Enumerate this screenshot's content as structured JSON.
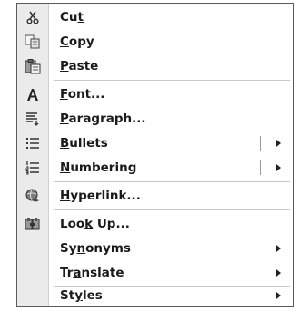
{
  "menu": {
    "items": [
      {
        "pre": "Cu",
        "u": "t",
        "post": "",
        "icon": "cut-icon"
      },
      {
        "pre": "",
        "u": "C",
        "post": "opy",
        "icon": "copy-icon"
      },
      {
        "pre": "",
        "u": "P",
        "post": "aste",
        "icon": "paste-icon"
      },
      {
        "pre": "",
        "u": "F",
        "post": "ont...",
        "icon": "font-icon"
      },
      {
        "pre": "",
        "u": "P",
        "post": "aragraph...",
        "icon": "paragraph-icon"
      },
      {
        "pre": "",
        "u": "B",
        "post": "ullets",
        "icon": "bullets-icon"
      },
      {
        "pre": "",
        "u": "N",
        "post": "umbering",
        "icon": "numbering-icon"
      },
      {
        "pre": "",
        "u": "H",
        "post": "yperlink...",
        "icon": "hyperlink-icon"
      },
      {
        "pre": "Loo",
        "u": "k",
        "post": " Up...",
        "icon": "look-up-icon"
      },
      {
        "pre": "Sy",
        "u": "n",
        "post": "onyms",
        "icon": ""
      },
      {
        "pre": "Tr",
        "u": "a",
        "post": "nslate",
        "icon": ""
      },
      {
        "pre": "St",
        "u": "y",
        "post": "les",
        "icon": ""
      }
    ]
  }
}
